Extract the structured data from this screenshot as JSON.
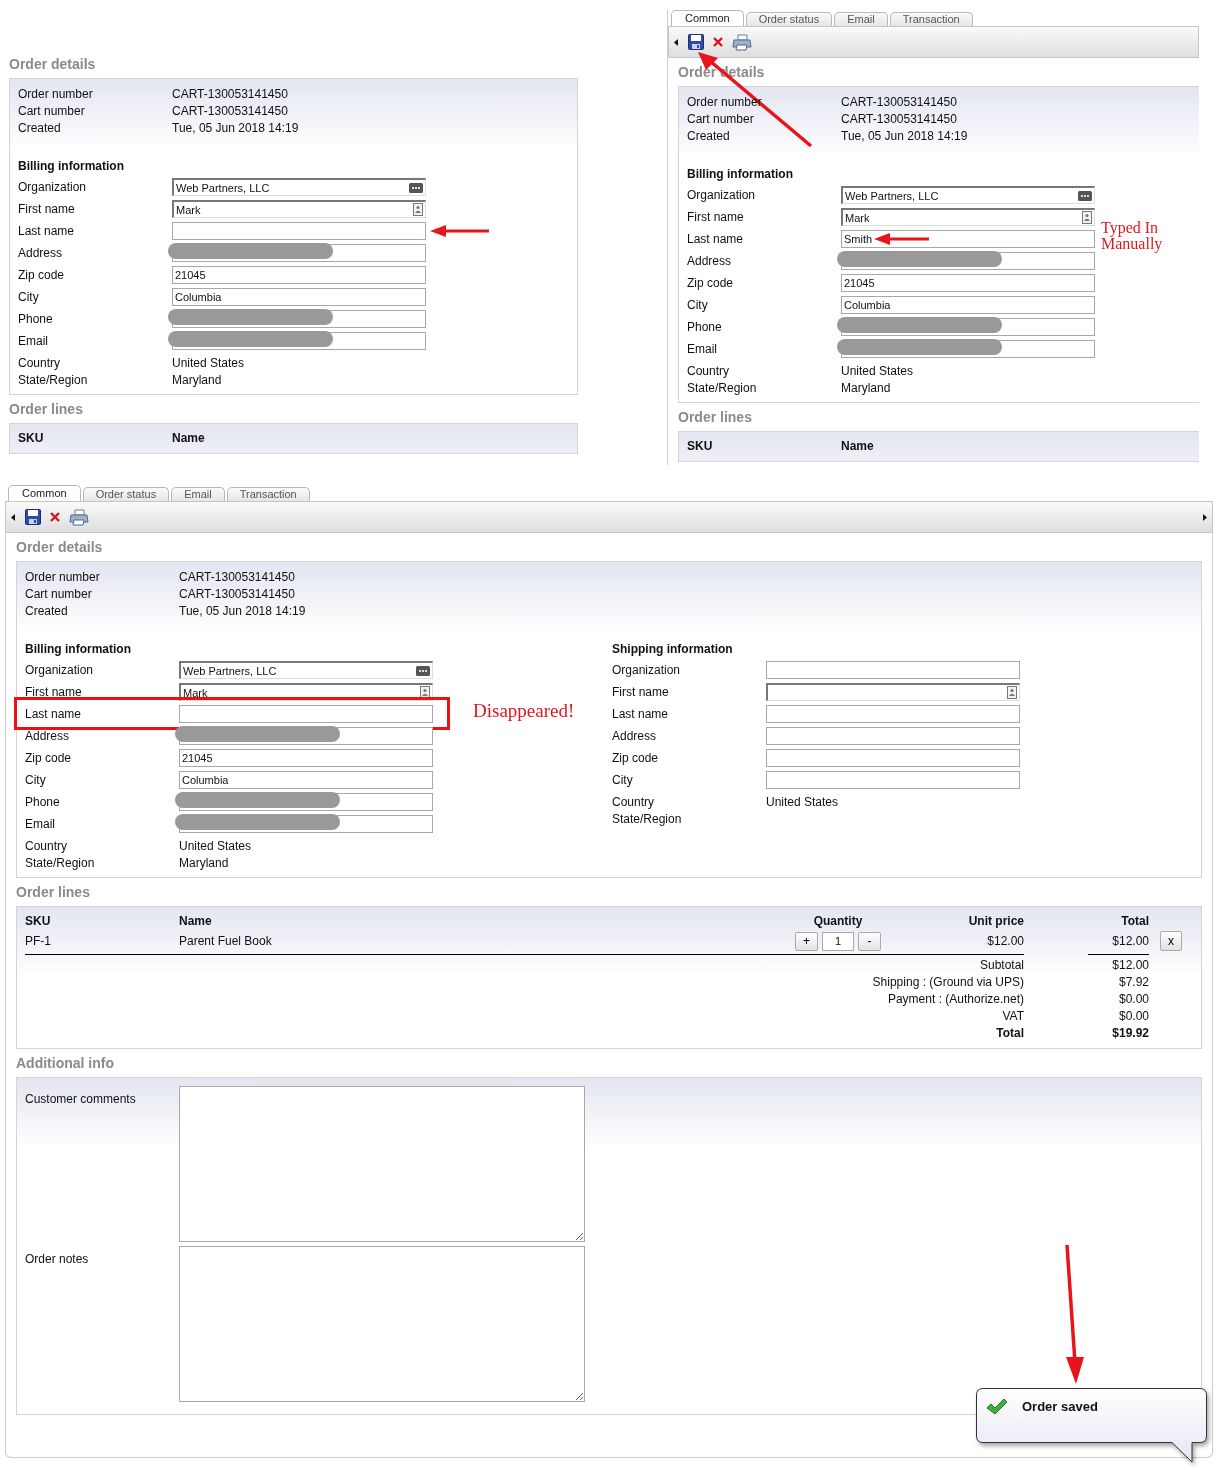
{
  "panels": [
    {
      "kind": "fragment",
      "order_details": {
        "title": "Order details",
        "rows": [
          {
            "label": "Order number",
            "value": "CART-130053141450"
          },
          {
            "label": "Cart number",
            "value": "CART-130053141450"
          },
          {
            "label": "Created",
            "value": "Tue, 05 Jun 2018 14:19"
          }
        ]
      },
      "billing": {
        "title": "Billing information",
        "rows": [
          {
            "label": "Organization",
            "kind": "lookup",
            "value": "Web Partners, LLC"
          },
          {
            "label": "First name",
            "kind": "contact",
            "value": "Mark"
          },
          {
            "label": "Last name",
            "kind": "input",
            "arrow": true
          },
          {
            "label": "Address",
            "kind": "redacted"
          },
          {
            "label": "Zip code",
            "kind": "input",
            "value": "21045"
          },
          {
            "label": "City",
            "kind": "input",
            "value": "Columbia"
          },
          {
            "label": "Phone",
            "kind": "redacted"
          },
          {
            "label": "Email",
            "kind": "redacted"
          },
          {
            "label": "Country",
            "kind": "static",
            "value": "United States"
          },
          {
            "label": "State/Region",
            "kind": "static",
            "value": "Maryland"
          }
        ]
      },
      "order_lines": {
        "title": "Order lines",
        "columns": [
          "SKU",
          "Name"
        ]
      }
    },
    {
      "kind": "cropped-window",
      "tabs": [
        {
          "label": "Common",
          "selected": true
        },
        {
          "label": "Order status",
          "selected": false
        },
        {
          "label": "Email",
          "selected": false
        },
        {
          "label": "Transaction",
          "selected": false
        }
      ],
      "save_arrow": true,
      "order_details": {
        "title": "Order details",
        "rows": [
          {
            "label": "Order number",
            "value": "CART-130053141450"
          },
          {
            "label": "Cart number",
            "value": "CART-130053141450"
          },
          {
            "label": "Created",
            "value": "Tue, 05 Jun 2018 14:19"
          }
        ]
      },
      "billing": {
        "title": "Billing information",
        "rows": [
          {
            "label": "Organization",
            "kind": "lookup",
            "value": "Web Partners, LLC"
          },
          {
            "label": "First name",
            "kind": "contact",
            "value": "Mark"
          },
          {
            "label": "Last name",
            "kind": "input",
            "value": "Smith",
            "arrow": true,
            "note": "Typed In Manually"
          },
          {
            "label": "Address",
            "kind": "redacted"
          },
          {
            "label": "Zip code",
            "kind": "input",
            "value": "21045"
          },
          {
            "label": "City",
            "kind": "input",
            "value": "Columbia"
          },
          {
            "label": "Phone",
            "kind": "redacted"
          },
          {
            "label": "Email",
            "kind": "redacted"
          },
          {
            "label": "Country",
            "kind": "static",
            "value": "United States"
          },
          {
            "label": "State/Region",
            "kind": "static",
            "value": "Maryland"
          }
        ]
      },
      "order_lines": {
        "title": "Order lines",
        "columns": [
          "SKU",
          "Name"
        ]
      }
    },
    {
      "kind": "full-window",
      "tabs": [
        {
          "label": "Common",
          "selected": true
        },
        {
          "label": "Order status",
          "selected": false
        },
        {
          "label": "Email",
          "selected": false
        },
        {
          "label": "Transaction",
          "selected": false
        }
      ],
      "order_details": {
        "title": "Order details",
        "rows": [
          {
            "label": "Order number",
            "value": "CART-130053141450"
          },
          {
            "label": "Cart number",
            "value": "CART-130053141450"
          },
          {
            "label": "Created",
            "value": "Tue, 05 Jun 2018 14:19"
          }
        ]
      },
      "billing": {
        "title": "Billing information",
        "rows": [
          {
            "label": "Organization",
            "kind": "lookup",
            "value": "Web Partners, LLC"
          },
          {
            "label": "First name",
            "kind": "contact",
            "value": "Mark"
          },
          {
            "label": "Last name",
            "kind": "input",
            "highlighted": true,
            "note": "Disappeared!"
          },
          {
            "label": "Address",
            "kind": "redacted"
          },
          {
            "label": "Zip code",
            "kind": "input",
            "value": "21045"
          },
          {
            "label": "City",
            "kind": "input",
            "value": "Columbia"
          },
          {
            "label": "Phone",
            "kind": "redacted"
          },
          {
            "label": "Email",
            "kind": "redacted"
          },
          {
            "label": "Country",
            "kind": "static",
            "value": "United States"
          },
          {
            "label": "State/Region",
            "kind": "static",
            "value": "Maryland"
          }
        ]
      },
      "shipping": {
        "title": "Shipping information",
        "rows": [
          {
            "label": "Organization",
            "kind": "input"
          },
          {
            "label": "First name",
            "kind": "contact"
          },
          {
            "label": "Last name",
            "kind": "input"
          },
          {
            "label": "Address",
            "kind": "input"
          },
          {
            "label": "Zip code",
            "kind": "input"
          },
          {
            "label": "City",
            "kind": "input"
          },
          {
            "label": "Country",
            "kind": "static",
            "value": "United States"
          },
          {
            "label": "State/Region",
            "kind": "static"
          }
        ]
      },
      "order_lines": {
        "title": "Order lines",
        "columns": [
          "SKU",
          "Name",
          "Quantity",
          "Unit price",
          "Total"
        ],
        "rows": [
          {
            "sku": "PF-1",
            "name": "Parent Fuel Book",
            "increase": "+",
            "quantity": "1",
            "decrease": "-",
            "unit_price": "$12.00",
            "total": "$12.00",
            "remove": "x"
          }
        ],
        "totals": [
          {
            "label": "Subtotal",
            "value": "$12.00",
            "kind": "normal"
          },
          {
            "label": "Shipping : (Ground via UPS)",
            "value": "$7.92",
            "kind": "normal"
          },
          {
            "label": "Payment : (Authorize.net)",
            "value": "$0.00",
            "kind": "normal"
          },
          {
            "label": "VAT",
            "value": "$0.00",
            "kind": "normal"
          },
          {
            "label": "Total",
            "value": "$19.92",
            "kind": "grand"
          }
        ]
      },
      "additional_info": {
        "title": "Additional info",
        "fields": [
          {
            "label": "Customer comments"
          },
          {
            "label": "Order notes"
          }
        ]
      },
      "notification": {
        "text": "Order saved",
        "arrow": true
      }
    }
  ]
}
